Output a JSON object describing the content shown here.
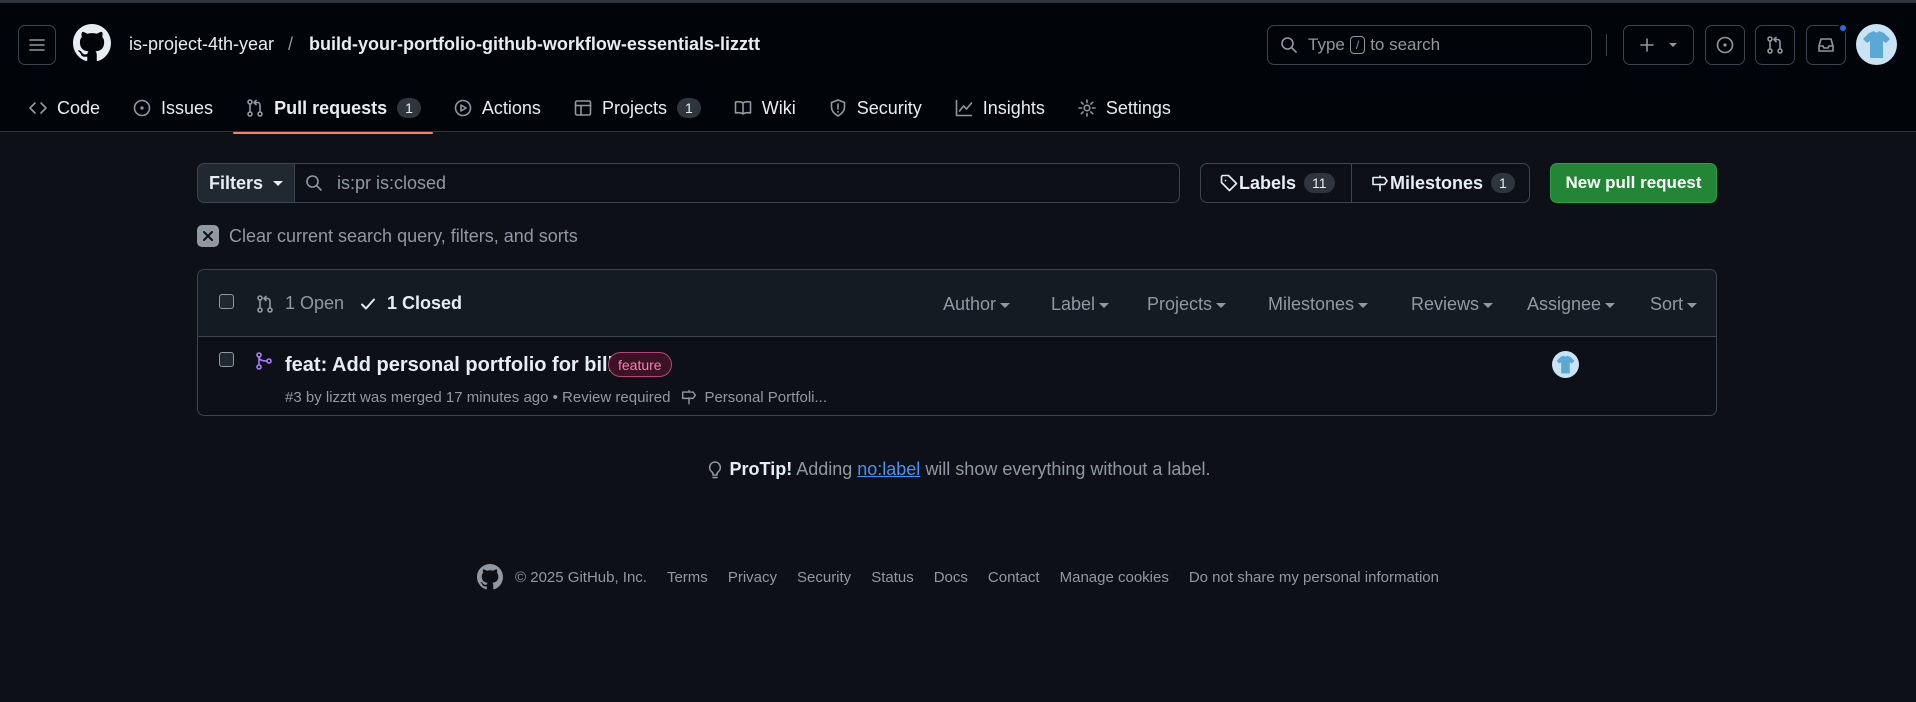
{
  "header": {
    "owner": "is-project-4th-year",
    "separator": "/",
    "repo": "build-your-portfolio-github-workflow-essentials-lizztt",
    "search": {
      "prefix": "Type",
      "key": "/",
      "suffix": "to search"
    }
  },
  "tabs": [
    {
      "label": "Code",
      "icon": "code-icon"
    },
    {
      "label": "Issues",
      "icon": "issue-icon"
    },
    {
      "label": "Pull requests",
      "icon": "pull-request-icon",
      "count": "1",
      "selected": true
    },
    {
      "label": "Actions",
      "icon": "play-icon"
    },
    {
      "label": "Projects",
      "icon": "table-icon",
      "count": "1"
    },
    {
      "label": "Wiki",
      "icon": "book-icon"
    },
    {
      "label": "Security",
      "icon": "shield-icon"
    },
    {
      "label": "Insights",
      "icon": "graph-icon"
    },
    {
      "label": "Settings",
      "icon": "gear-icon"
    }
  ],
  "toolbar": {
    "filters_label": "Filters",
    "query": "is:pr is:closed",
    "labels_label": "Labels",
    "labels_count": "11",
    "milestones_label": "Milestones",
    "milestones_count": "1",
    "new_pr_label": "New pull request",
    "clear_label": "Clear current search query, filters, and sorts"
  },
  "list_header": {
    "open_label": "1 Open",
    "closed_label": "1 Closed",
    "filters": [
      "Author",
      "Label",
      "Projects",
      "Milestones",
      "Reviews",
      "Assignee",
      "Sort"
    ]
  },
  "pull_requests": [
    {
      "title": "feat: Add personal portfolio for bill",
      "label": "feature",
      "meta": "#3 by lizztt was merged 17 minutes ago • Review required",
      "milestone": "Personal Portfoli..."
    }
  ],
  "protip": {
    "strong": "ProTip!",
    "before": "Adding",
    "link": "no:label",
    "after": "will show everything without a label."
  },
  "footer": {
    "copyright": "© 2025 GitHub, Inc.",
    "links": [
      "Terms",
      "Privacy",
      "Security",
      "Status",
      "Docs",
      "Contact",
      "Manage cookies",
      "Do not share my personal information"
    ]
  },
  "colors": {
    "accent_tab": "#f78166",
    "primary_button": "#238636",
    "merged_purple": "#ab7df8",
    "link": "#4493f8",
    "label_feature": "#ff7bb0"
  }
}
